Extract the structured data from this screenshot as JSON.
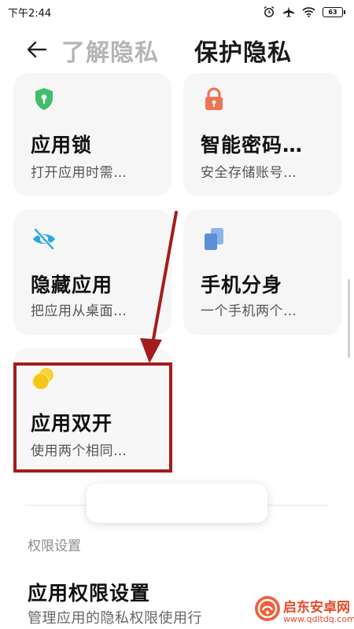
{
  "status_bar": {
    "time": "下午2:44",
    "battery": "63",
    "icons": [
      "alarm-icon",
      "airplane-icon",
      "wifi-icon",
      "battery-icon"
    ]
  },
  "header": {
    "tab_inactive": "了解隐私",
    "tab_active": "保护隐私",
    "back_icon": "back-arrow-icon"
  },
  "cards": [
    {
      "name": "app-lock",
      "icon": "shield-icon",
      "icon_color": "#3fbf6a",
      "title": "应用锁",
      "subtitle": "打开应用时需…"
    },
    {
      "name": "smart-password",
      "icon": "lock-icon",
      "icon_color": "#f07356",
      "title": "智能密码…",
      "subtitle": "安全存储账号…"
    },
    {
      "name": "hidden-apps",
      "icon": "eye-off-icon",
      "icon_color": "#2aa9d9",
      "title": "隐藏应用",
      "subtitle": "把应用从桌面…"
    },
    {
      "name": "second-space",
      "icon": "copy-icon",
      "icon_color": "#5b8fd6",
      "title": "手机分身",
      "subtitle": "一个手机两个…"
    },
    {
      "name": "dual-apps",
      "icon": "dual-circle-icon",
      "icon_color": "#f5c518",
      "title": "应用双开",
      "subtitle": "使用两个相同…"
    }
  ],
  "permissions": {
    "section_label": "权限设置",
    "row_title": "应用权限设置",
    "row_subtitle": "管理应用的隐私权限使用行"
  },
  "watermark": {
    "text": "启东安卓网",
    "url": "www.qdltdq.com"
  },
  "colors": {
    "annotation": "#a51c1c",
    "card_bg": "#f6f6f6",
    "inactive_tab": "#b5b5b5"
  }
}
